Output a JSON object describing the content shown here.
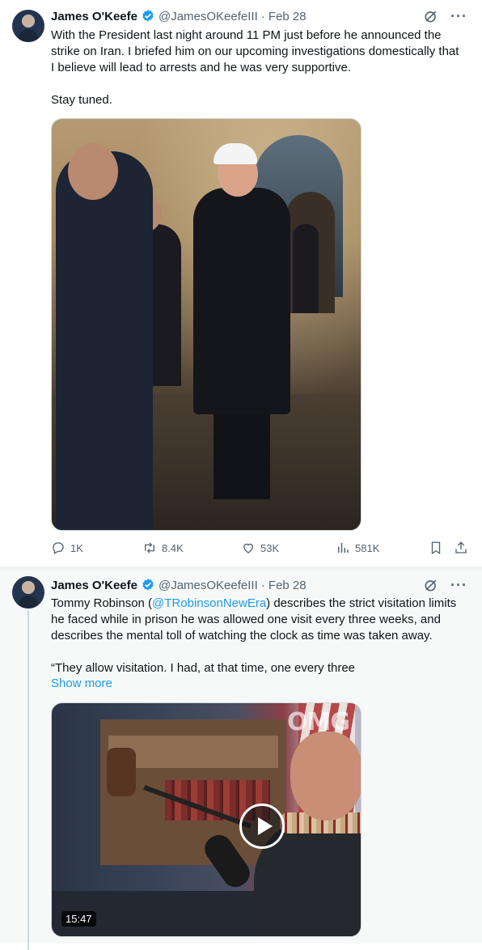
{
  "tweets": [
    {
      "author_name": "James O'Keefe",
      "handle": "@JamesOKeefeIII",
      "date": "· Feb 28",
      "text_paragraphs": [
        "With the President last night around 11 PM just before he announced the strike on Iran. I briefed him on our upcoming investigations domestically that I believe will lead to arrests and he was very supportive.",
        "Stay tuned."
      ],
      "media_type": "photo",
      "stats": {
        "replies": "1K",
        "retweets": "8.4K",
        "likes": "53K",
        "views": "581K"
      }
    },
    {
      "author_name": "James O'Keefe",
      "handle": "@JamesOKeefeIII",
      "date": "· Feb 28",
      "text_before_mention": "Tommy Robinson (",
      "mention": "@TRobinsonNewEra",
      "text_after_mention": ") describes the strict visitation limits he faced while in prison he was allowed one visit every three weeks, and describes the mental toll of watching the clock as time was taken away.",
      "quote_text": "“They allow visitation. I had, at that time, one every three",
      "show_more": "Show more",
      "media_type": "video",
      "video_duration": "15:47",
      "video_watermark": "OMG"
    }
  ],
  "colors": {
    "accent": "#1d9bf0",
    "text": "#0f1419",
    "secondary": "#536471"
  },
  "icons": [
    "verified-badge-icon",
    "grok-icon",
    "more-icon",
    "reply-icon",
    "retweet-icon",
    "like-icon",
    "views-icon",
    "bookmark-icon",
    "share-icon",
    "play-icon"
  ]
}
